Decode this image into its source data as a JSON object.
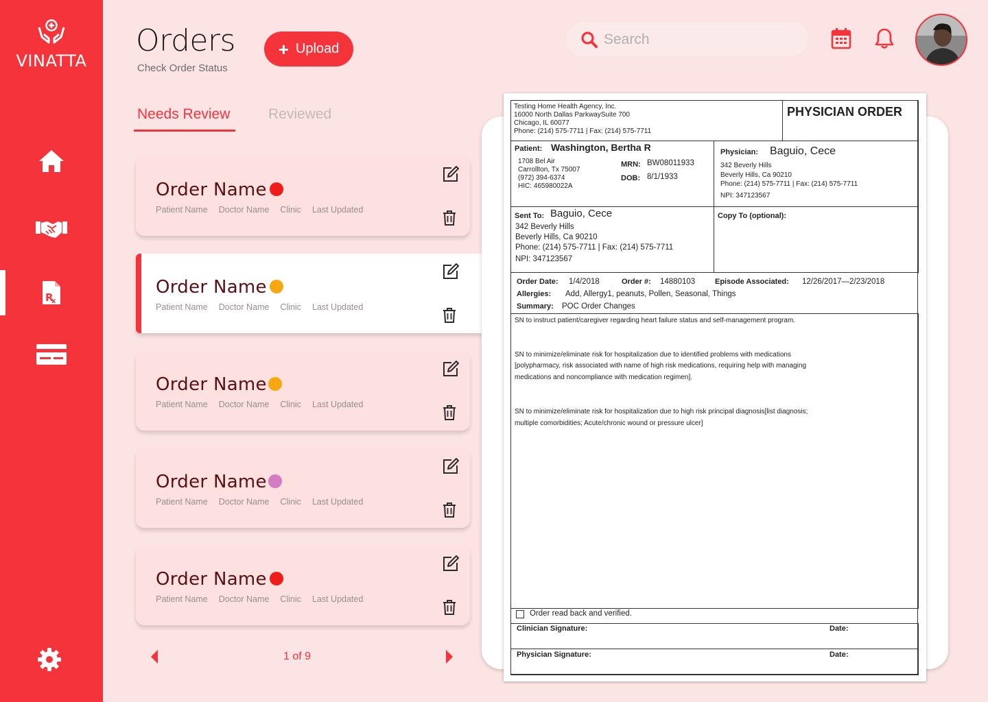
{
  "brand": {
    "name": "VINATTA"
  },
  "sidebar": {
    "items": [
      {
        "name": "home",
        "icon": "home-icon"
      },
      {
        "name": "partners",
        "icon": "handshake-icon"
      },
      {
        "name": "orders",
        "icon": "prescription-icon",
        "active": true
      },
      {
        "name": "billing",
        "icon": "credit-card-icon"
      }
    ],
    "settings_icon": "gear-icon"
  },
  "header": {
    "title": "Orders",
    "subtitle": "Check Order Status",
    "upload_label": "Upload",
    "search_placeholder": "Search"
  },
  "tabs": [
    {
      "label": "Needs Review",
      "active": true
    },
    {
      "label": "Reviewed",
      "active": false
    }
  ],
  "orders": [
    {
      "title": "Order Name",
      "status_color": "#f01c1c",
      "patient": "Patient Name",
      "doctor": "Doctor Name",
      "clinic": "Clinic",
      "updated": "Last Updated"
    },
    {
      "title": "Order Name",
      "status_color": "#f7a712",
      "patient": "Patient Name",
      "doctor": "Doctor Name",
      "clinic": "Clinic",
      "updated": "Last Updated",
      "selected": true
    },
    {
      "title": "Order Name",
      "status_color": "#f7a712",
      "patient": "Patient Name",
      "doctor": "Doctor Name",
      "clinic": "Clinic",
      "updated": "Last Updated"
    },
    {
      "title": "Order Name",
      "status_color": "#d47cc2",
      "patient": "Patient Name",
      "doctor": "Doctor Name",
      "clinic": "Clinic",
      "updated": "Last Updated"
    },
    {
      "title": "Order Name",
      "status_color": "#f01c1c",
      "patient": "Patient Name",
      "doctor": "Doctor Name",
      "clinic": "Clinic",
      "updated": "Last Updated"
    }
  ],
  "pagination": {
    "text": "1 of 9"
  },
  "colors": {
    "accent": "#f5333a",
    "background": "#fde4e4",
    "card": "#fde0e0"
  },
  "document": {
    "agency_lines": [
      "Testing Home Health Agency, Inc.",
      "16000 North Dallas ParkwaySuite 700",
      "Chicago, IL 60077",
      "Phone: (214) 575-7711 | Fax: (214) 575-7711"
    ],
    "heading": "PHYSICIAN ORDER",
    "patient_label": "Patient:",
    "patient_name": "Washington, Bertha R",
    "patient_lines": [
      "1708 Bel Air",
      "Carrollton, Tx 75007",
      "(972) 394-6374",
      "HIC: 465980022A"
    ],
    "mrn_label": "MRN:",
    "mrn": "BW08011933",
    "dob_label": "DOB:",
    "dob": "8/1/1933",
    "physician_label": "Physician:",
    "physician_name": "Baguio, Cece",
    "physician_lines": [
      "342 Beverly Hills",
      "Beverly Hills, Ca 90210",
      "Phone: (214) 575-7711 | Fax: (214) 575-7711",
      "NPI: 347123567"
    ],
    "sent_to_label": "Sent To:",
    "sent_to_name": "Baguio, Cece",
    "sent_to_lines": [
      "342 Beverly Hills",
      "Beverly Hills, Ca 90210",
      "Phone: (214) 575-7711 | Fax: (214) 575-7711",
      "NPI: 347123567"
    ],
    "copy_to_label": "Copy To (optional):",
    "order_date_label": "Order Date:",
    "order_date": "1/4/2018",
    "order_no_label": "Order #:",
    "order_no": "14880103",
    "episode_label": "Episode Associated:",
    "episode": "12/26/2017—2/23/2018",
    "allergies_label": "Allergies:",
    "allergies": "Add, Allergy1, peanuts, Pollen, Seasonal, Things",
    "summary_label": "Summary:",
    "summary": "POC Order Changes",
    "body": [
      "SN to instruct patient/caregiver regarding heart failure status and self-management program.",
      "SN to minimize/eliminate risk for hospitalization due to identified problems with medications",
      "[polypharmacy, risk associated with name of high risk medications, requiring help with managing",
      "medications and noncompliance with medication regimen].",
      "SN to minimize/eliminate risk for hospitalization due to high risk principal diagnosis[list diagnosis;",
      "multiple comorbidities; Acute/chronic wound or pressure ulcer]"
    ],
    "readback": "Order read back and verified.",
    "clinician_sig_label": "Clinician Signature:",
    "physician_sig_label": "Physician Signature:",
    "date_label": "Date:"
  }
}
